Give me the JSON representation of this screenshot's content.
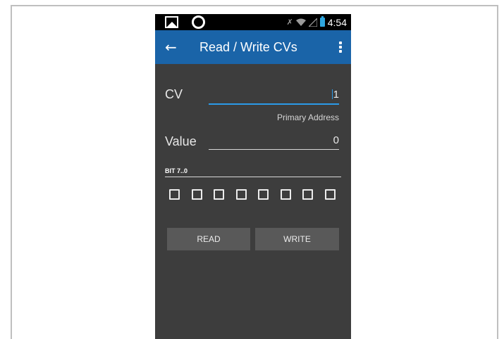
{
  "status_bar": {
    "time": "4:54",
    "icons": [
      "picture-icon",
      "circle-icon",
      "mute-icon",
      "wifi-icon",
      "signal-icon",
      "battery-icon"
    ]
  },
  "app_bar": {
    "title": "Read / Write CVs",
    "back_icon": "arrow-left-icon",
    "overflow_icon": "more-vert-icon",
    "color": "#1a64a8"
  },
  "form": {
    "cv": {
      "label": "CV",
      "value": "1",
      "hint": "Primary Address"
    },
    "value": {
      "label": "Value",
      "value": "0"
    },
    "bits": {
      "label": "BIT 7..0",
      "checkboxes": [
        false,
        false,
        false,
        false,
        false,
        false,
        false,
        false
      ]
    }
  },
  "buttons": {
    "read": "READ",
    "write": "WRITE"
  },
  "colors": {
    "background": "#3d3d3d",
    "accent": "#2b9be8",
    "button": "#595959"
  }
}
